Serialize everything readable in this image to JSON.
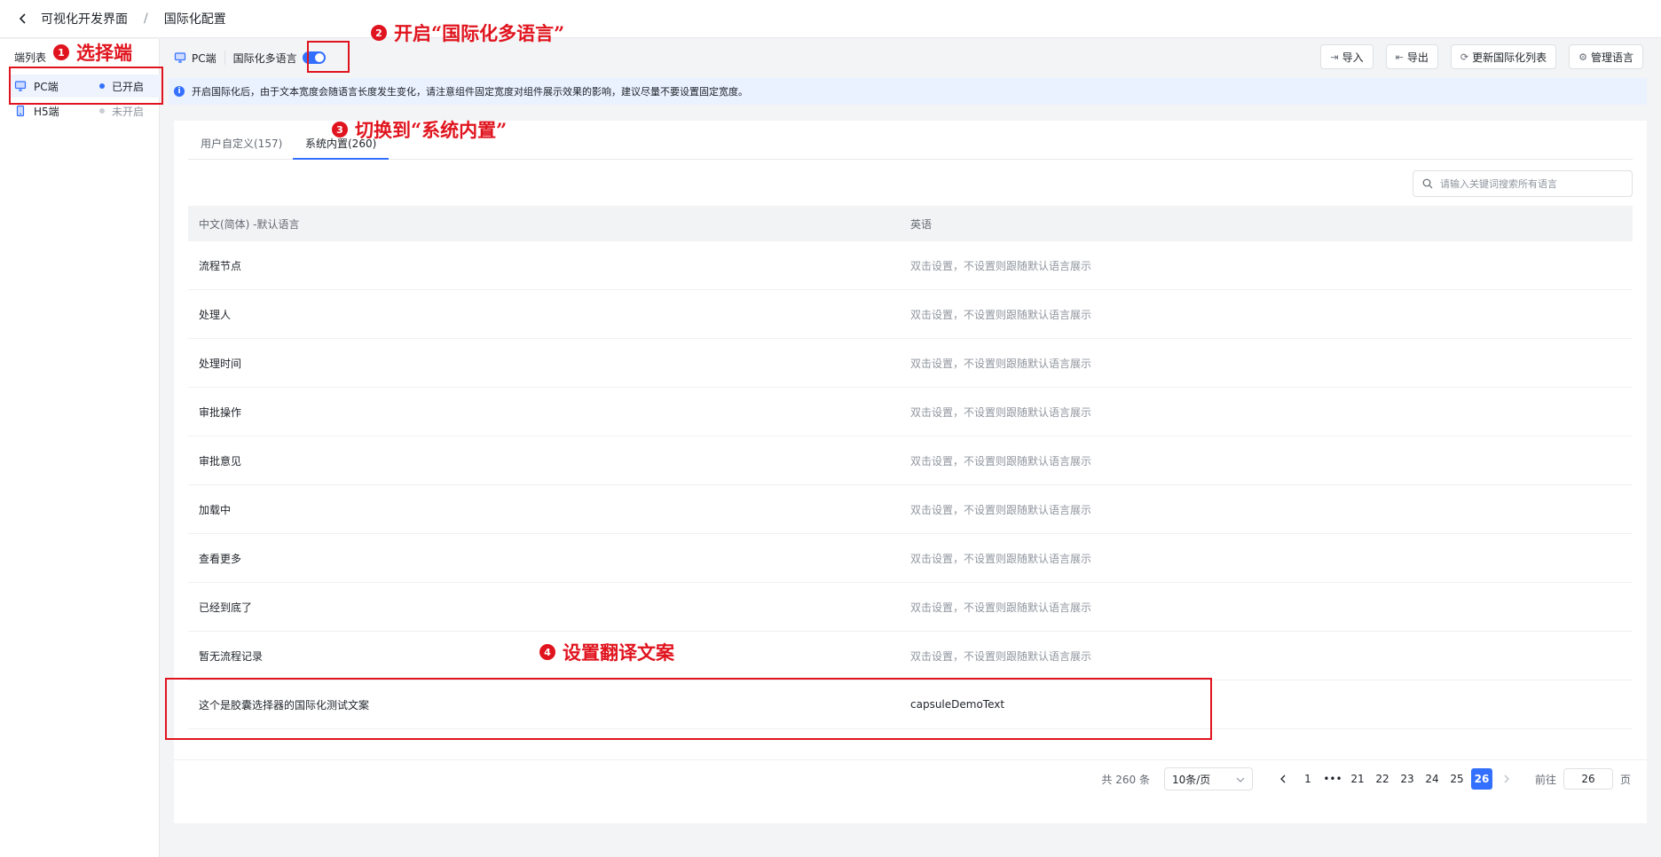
{
  "header": {
    "breadcrumb_parent": "可视化开发界面",
    "breadcrumb_sep": "/",
    "breadcrumb_current": "国际化配置"
  },
  "sidebar": {
    "title": "端列表",
    "items": [
      {
        "label": "PC端",
        "status": "已开启",
        "active": true
      },
      {
        "label": "H5端",
        "status": "未开启",
        "active": false
      }
    ]
  },
  "toolbar": {
    "platform": "PC端",
    "i18n_label": "国际化多语言",
    "i18n_enabled": true,
    "buttons": [
      {
        "label": "导入",
        "icon": "import-icon"
      },
      {
        "label": "导出",
        "icon": "export-icon"
      },
      {
        "label": "更新国际化列表",
        "icon": "refresh-icon"
      },
      {
        "label": "管理语言",
        "icon": "settings-icon"
      }
    ]
  },
  "banner": {
    "text": "开启国际化后，由于文本宽度会随语言长度发生变化，请注意组件固定宽度对组件展示效果的影响，建议尽量不要设置固定宽度。"
  },
  "tabs": [
    {
      "label": "用户自定义(157)",
      "active": false
    },
    {
      "label": "系统内置(260)",
      "active": true
    }
  ],
  "search": {
    "placeholder": "请输入关键词搜索所有语言",
    "value": ""
  },
  "table": {
    "columns": [
      "中文(简体) -默认语言",
      "英语"
    ],
    "placeholder_text": "双击设置，不设置则跟随默认语言展示",
    "rows": [
      {
        "zh": "流程节点",
        "en": "双击设置，不设置则跟随默认语言展示",
        "empty": true
      },
      {
        "zh": "处理人",
        "en": "双击设置，不设置则跟随默认语言展示",
        "empty": true
      },
      {
        "zh": "处理时间",
        "en": "双击设置，不设置则跟随默认语言展示",
        "empty": true
      },
      {
        "zh": "审批操作",
        "en": "双击设置，不设置则跟随默认语言展示",
        "empty": true
      },
      {
        "zh": "审批意见",
        "en": "双击设置，不设置则跟随默认语言展示",
        "empty": true
      },
      {
        "zh": "加载中",
        "en": "双击设置，不设置则跟随默认语言展示",
        "empty": true
      },
      {
        "zh": "查看更多",
        "en": "双击设置，不设置则跟随默认语言展示",
        "empty": true
      },
      {
        "zh": "已经到底了",
        "en": "双击设置，不设置则跟随默认语言展示",
        "empty": true
      },
      {
        "zh": "暂无流程记录",
        "en": "双击设置，不设置则跟随默认语言展示",
        "empty": true
      },
      {
        "zh": "这个是胶囊选择器的国际化测试文案",
        "en": "capsuleDemoText",
        "empty": false
      }
    ]
  },
  "pagination": {
    "total": "共 260 条",
    "page_size": "10条/页",
    "pages": [
      "1",
      "•••",
      "21",
      "22",
      "23",
      "24",
      "25",
      "26"
    ],
    "current": "26",
    "goto_label": "前往",
    "goto_value": "26",
    "page_suffix": "页"
  },
  "annotations": [
    {
      "num": "1",
      "text": "选择端"
    },
    {
      "num": "2",
      "text": "开启“国际化多语言”"
    },
    {
      "num": "3",
      "text": "切换到“系统内置”"
    },
    {
      "num": "4",
      "text": "设置翻译文案"
    }
  ],
  "colors": {
    "accent": "#3370ff",
    "annotation": "#e0141e"
  }
}
